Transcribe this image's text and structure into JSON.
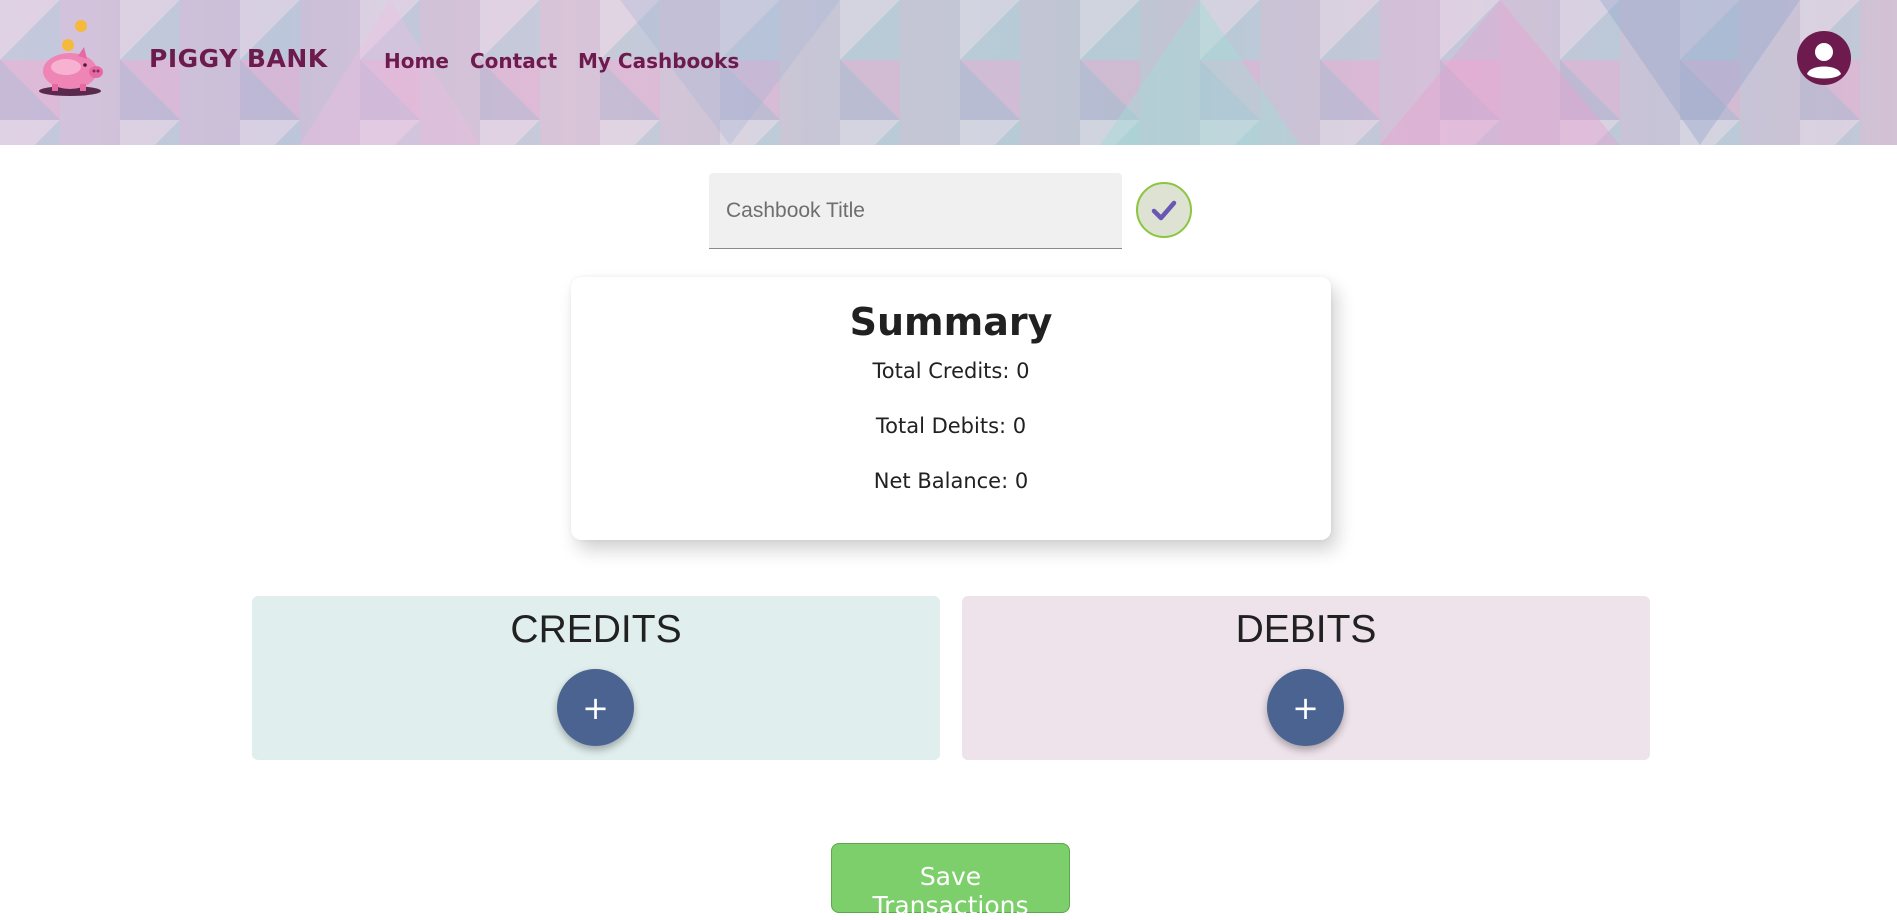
{
  "header": {
    "brand": "PIGGY BANK",
    "nav": [
      {
        "label": "Home"
      },
      {
        "label": "Contact"
      },
      {
        "label": "My Cashbooks"
      }
    ]
  },
  "cashbook": {
    "title_placeholder": "Cashbook Title",
    "title_value": ""
  },
  "summary": {
    "heading": "Summary",
    "total_credits": "Total Credits: 0",
    "total_debits": "Total Debits: 0",
    "net_balance": "Net Balance: 0"
  },
  "credits": {
    "title": "CREDITS",
    "add_label": "+"
  },
  "debits": {
    "title": "DEBITS",
    "add_label": "+"
  },
  "save_label": "Save Transactions",
  "icons": {
    "logo": "piggy-bank-icon",
    "avatar": "user-account-icon",
    "confirm": "checkmark-icon"
  },
  "colors": {
    "brand": "#6d1b4e",
    "accent_button": "#4a6391",
    "save_green": "#7ccf6a",
    "credits_bg": "#e0eeee",
    "debits_bg": "#eee2eb"
  }
}
